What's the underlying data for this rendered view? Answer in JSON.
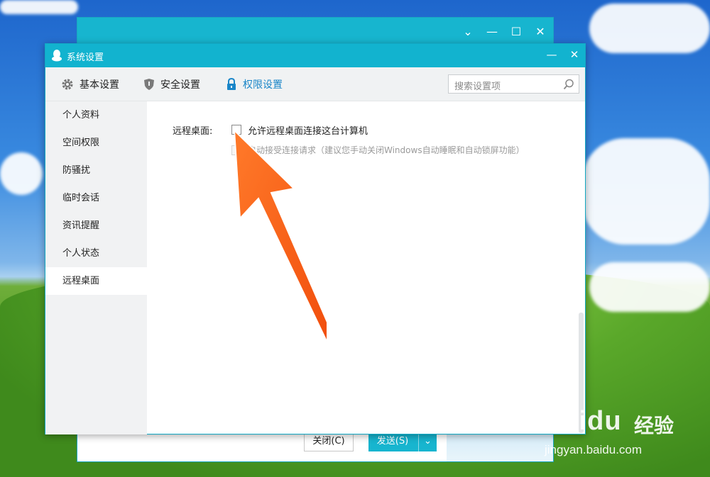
{
  "settings_window": {
    "title": "系统设置",
    "tabs": [
      {
        "label": "基本设置",
        "icon": "gear-icon"
      },
      {
        "label": "安全设置",
        "icon": "shield-icon"
      },
      {
        "label": "权限设置",
        "icon": "lock-icon"
      }
    ],
    "active_tab": "权限设置",
    "search_placeholder": "搜索设置项",
    "sidebar": [
      "个人资料",
      "空间权限",
      "防骚扰",
      "临时会话",
      "资讯提醒",
      "个人状态",
      "远程桌面"
    ],
    "active_sidebar": "远程桌面",
    "section_label": "远程桌面:",
    "options": [
      {
        "label": "允许远程桌面连接这台计算机",
        "checked": false,
        "enabled": true
      },
      {
        "label": "自动接受连接请求（建议您手动关闭Windows自动睡眠和自动锁屏功能）",
        "checked": false,
        "enabled": false
      }
    ],
    "colors": {
      "accent": "#12b3cf",
      "active_tab": "#1a86c8",
      "arrow": "#ff5a14"
    }
  },
  "chat_window": {
    "close_button": "关闭(C)",
    "send_button": "发送(S)"
  },
  "watermark": {
    "brand": "Baidu",
    "cn": "经验",
    "url": "jingyan.baidu.com"
  }
}
